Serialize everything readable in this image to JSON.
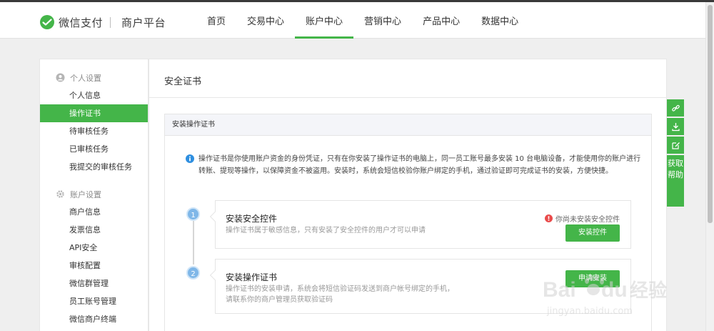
{
  "header": {
    "brand": "微信支付",
    "product": "商户平台",
    "nav": [
      {
        "label": "首页"
      },
      {
        "label": "交易中心"
      },
      {
        "label": "账户中心",
        "active": true
      },
      {
        "label": "营销中心"
      },
      {
        "label": "产品中心"
      },
      {
        "label": "数据中心"
      }
    ]
  },
  "sidebar": {
    "group1": "个人设置",
    "items1": [
      "个人信息",
      "操作证书",
      "待审核任务",
      "已审核任务",
      "我提交的审核任务"
    ],
    "group2": "账户设置",
    "items2": [
      "商户信息",
      "发票信息",
      "API安全",
      "审核配置",
      "微信群管理",
      "员工账号管理",
      "微信商户终端"
    ]
  },
  "main": {
    "title": "安全证书",
    "box_title": "安装操作证书",
    "info_text": "操作证书是你使用账户资金的身份凭证，只有在你安装了操作证书的电脑上，同一员工账号最多安装 10 台电脑设备，才能使用你的账户进行转账、提现等操作，以保障资金不被盗用。安装时，系统会短信校验你账户绑定的手机，通过验证即可完成证书的安装，方便快捷。",
    "step1": {
      "num": "1",
      "title": "安装安全控件",
      "desc": "操作证书属于敏感信息，只有安装了安全控件的用户才可以申请",
      "warning": "你尚未安装安全控件",
      "button": "安装控件"
    },
    "step2": {
      "num": "2",
      "title": "安装操作证书",
      "desc1": "操作证书的安装申请，系统会将短信验证码发送到商户帐号绑定的手机，",
      "desc2": "请联系你的商户管理员获取验证码",
      "button": "申请安装"
    }
  },
  "tools": {
    "help": "获取帮助"
  },
  "watermark": {
    "brand": "Bai",
    "brand2": "du",
    "cn": "经验",
    "url": "jingyan.baidu.com"
  },
  "colors": {
    "accent": "#44b549",
    "step": "#7fb7e8",
    "warning": "#e94b4b"
  }
}
